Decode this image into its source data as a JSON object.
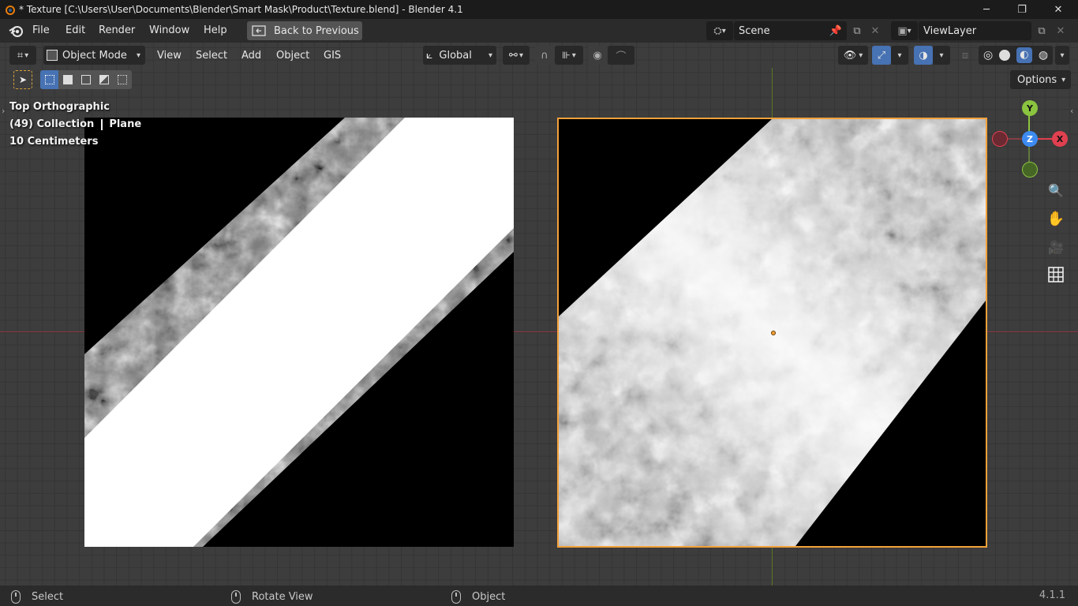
{
  "window": {
    "title": "* Texture [C:\\Users\\User\\Documents\\Blender\\Smart Mask\\Product\\Texture.blend] - Blender 4.1",
    "minimize": "─",
    "restore": "❐",
    "close": "✕"
  },
  "menu": {
    "items": [
      "File",
      "Edit",
      "Render",
      "Window",
      "Help"
    ],
    "back_button": "Back to Previous",
    "scene": "Scene",
    "view_layer": "ViewLayer"
  },
  "viewport_header": {
    "mode": "Object Mode",
    "menus": [
      "View",
      "Select",
      "Add",
      "Object",
      "GIS"
    ],
    "transform_orientation": "Global",
    "options": "Options"
  },
  "overlay": {
    "view_name": "Top Orthographic",
    "collection": "(49) Collection",
    "object": "Plane",
    "scale": "10 Centimeters"
  },
  "gizmo": {
    "y": "Y",
    "z": "Z",
    "x": "X"
  },
  "statusbar": {
    "select": "Select",
    "rotate": "Rotate View",
    "object": "Object",
    "version": "4.1.1"
  },
  "colors": {
    "accent_blue": "#4772b3",
    "selection_orange": "#f3a13a",
    "x_axis": "#e0404f",
    "y_axis": "#8bc43f",
    "z_axis": "#3d8bf2"
  }
}
